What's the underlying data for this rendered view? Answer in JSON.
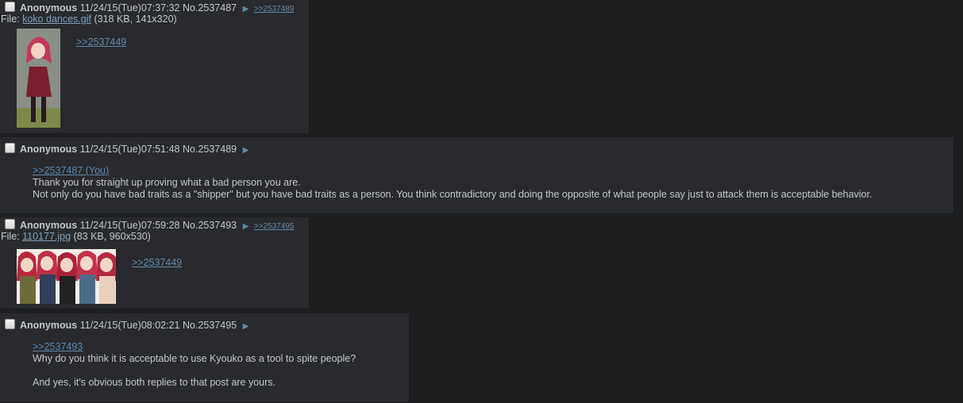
{
  "posts": [
    {
      "name": "Anonymous",
      "datetime": "11/24/15(Tue)07:37:32",
      "number": "No.2537487",
      "arrow": "▶",
      "backlink": ">>2537489",
      "file_label": "File:",
      "file_name": "koko dances.gif",
      "file_meta": "(318 KB, 141x320)",
      "quote": ">>2537449"
    },
    {
      "name": "Anonymous",
      "datetime": "11/24/15(Tue)07:51:48",
      "number": "No.2537489",
      "arrow": "▶",
      "quote": ">>2537487 (You)",
      "line1": "Thank you for straight up proving what a bad person you are.",
      "line2": "Not only do you have bad traits as a \"shipper\" but you have bad traits as a person. You think contradictory and doing the opposite of what people say just to attack them is acceptable behavior."
    },
    {
      "name": "Anonymous",
      "datetime": "11/24/15(Tue)07:59:28",
      "number": "No.2537493",
      "arrow": "▶",
      "backlink": ">>2537495",
      "file_label": "File:",
      "file_name": "110177.jpg",
      "file_meta": "(83 KB, 960x530)",
      "quote": ">>2537449"
    },
    {
      "name": "Anonymous",
      "datetime": "11/24/15(Tue)08:02:21",
      "number": "No.2537495",
      "arrow": "▶",
      "quote": ">>2537493",
      "line1": "Why do you think it is acceptable to use Kyouko as a tool to spite people?",
      "line2": "And yes, it's obvious both replies to that post are yours."
    }
  ],
  "colors": {
    "page_bg": "#1d1f21",
    "post_bg": "#282a2e",
    "text": "#c5c8c6",
    "link": "#5f89ac",
    "file_link": "#81a2be"
  }
}
